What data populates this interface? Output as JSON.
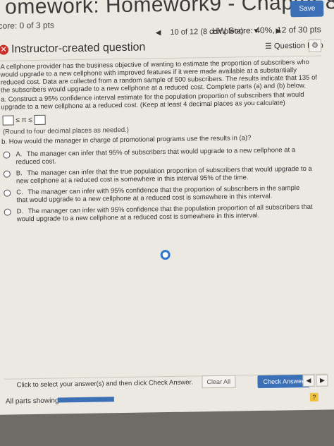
{
  "header": {
    "title": "omework: Homework9 - Chapter 8",
    "save_label": "Save",
    "score": "core: 0 of 3 pts",
    "nav_text": "10 of 12 (8 complete)",
    "hw_score": "HW Score: 40%, 12 of 30 pts"
  },
  "question": {
    "title": "Instructor-created question",
    "help_label": "Question Help",
    "body": "A cellphone provider has the business objective of wanting to estimate the proportion of subscribers who would upgrade to a new cellphone with improved features if it were made available at a substantially reduced cost. Data are collected from a random sample of 500 subscribers. The results indicate that 135 of the subscribers would upgrade to a new cellphone at a reduced cost. Complete parts (a) and (b) below.",
    "part_a": "a. Construct a 95% confidence interval estimate for the population proportion of subscribers that would upgrade to a new cellphone at a reduced cost. (Keep at least 4 decimal places as you calculate)",
    "ci_between": "≤ π ≤",
    "round_note": "(Round to four decimal places as needed.)",
    "part_b": "b. How would the manager in charge of promotional programs use the results in (a)?",
    "options": [
      {
        "letter": "A.",
        "text": "The manager can infer that 95% of subscribers that would upgrade to a new cellphone at a reduced cost."
      },
      {
        "letter": "B.",
        "text": "The manager can infer that the true population proportion of subscribers that would upgrade to a new cellphone at a reduced cost is somewhere in this interval 95% of the time."
      },
      {
        "letter": "C.",
        "text": "The manager can infer with 95% confidence that the proportion of subscribers in the sample that would upgrade to a new cellphone at a reduced cost is somewhere in this interval."
      },
      {
        "letter": "D.",
        "text": "The manager can infer with 95% confidence that the population proportion of all subscribers that would upgrade to a new cellphone at a reduced cost is somewhere in this interval."
      }
    ]
  },
  "footer": {
    "instruction": "Click to select your answer(s) and then click Check Answer.",
    "clear_label": "Clear All",
    "check_label": "Check Answer",
    "all_parts": "All parts showing"
  }
}
